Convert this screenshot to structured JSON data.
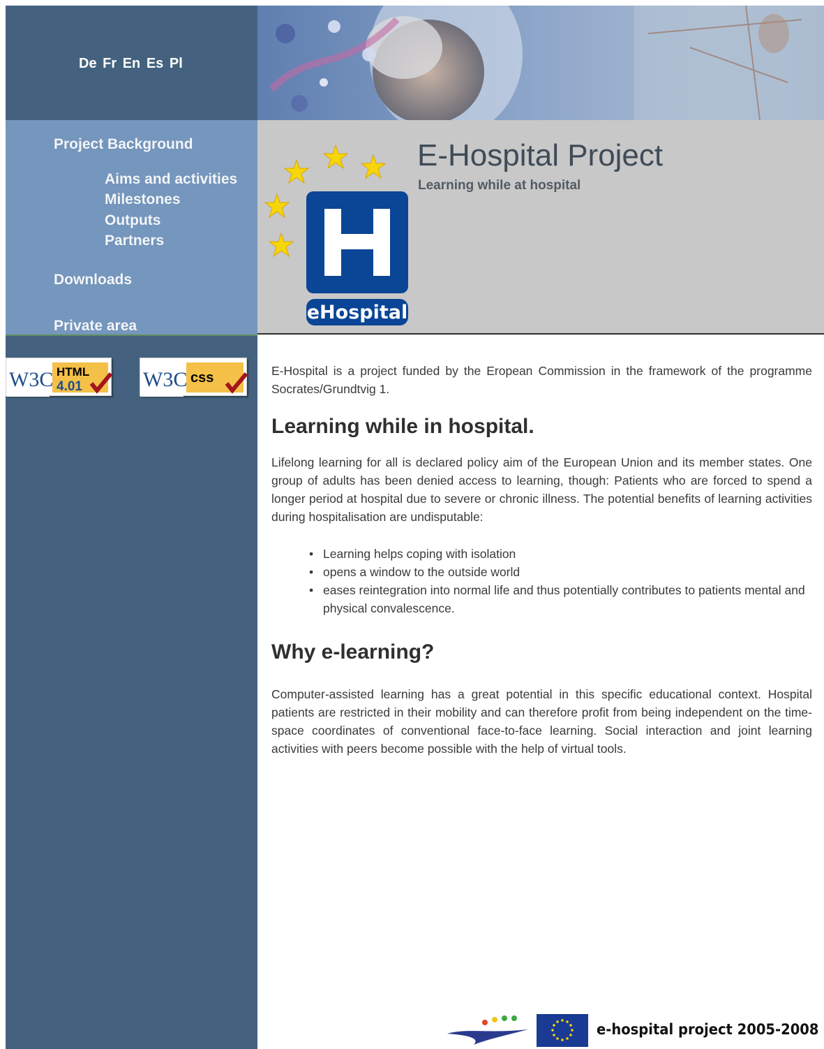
{
  "languages": [
    "De",
    "Fr",
    "En",
    "Es",
    "Pl"
  ],
  "nav": {
    "project_background": "Project Background",
    "sub_items": [
      "Aims and activities",
      "Milestones",
      "Outputs",
      "Partners"
    ],
    "downloads": "Downloads",
    "private_area": "Private area"
  },
  "badges": {
    "html": {
      "w3c": "W3C",
      "label": "HTML",
      "version": "4.01"
    },
    "css": {
      "w3c": "W3C",
      "label": "css"
    }
  },
  "header": {
    "title": "E-Hospital Project",
    "subtitle": "Learning while at hospital",
    "logo_letter": "H",
    "logo_text": "eHospital"
  },
  "main": {
    "intro": "E-Hospital is a project funded by the Eropean Commission in the framework of the programme Socrates/Grundtvig 1.",
    "heading1": "Learning while in hospital.",
    "paragraph1": "Lifelong learning for all is declared policy aim of the European Union and its member states. One group of adults has been denied access to learning, though: Patients who are forced to spend a longer period at hospital due to severe or chronic illness. The potential benefits of learning activities during hospitalisation are undisputable:",
    "benefits": [
      "Learning helps coping with isolation",
      "opens a window to the outside world",
      "eases reintegration into normal life and thus potentially contributes to patients mental and physical convalescence."
    ],
    "heading2": "Why e-learning?",
    "paragraph2": "Computer-assisted learning has a great potential in this specific educational context. Hospital patients are restricted in their mobility and can therefore profit from being independent on the time-space coordinates of conventional face-to-face learning. Social interaction and joint learning activities with peers become possible with the help of virtual tools."
  },
  "footer": {
    "text": "e-hospital project 2005-2008"
  },
  "colors": {
    "sidebar": "#44627f",
    "nav": "#7596bd",
    "header_bg": "#c8c8c8",
    "logo_blue": "#0b4596",
    "star_yellow": "#f6d50a",
    "eu_blue": "#1a3a94"
  }
}
